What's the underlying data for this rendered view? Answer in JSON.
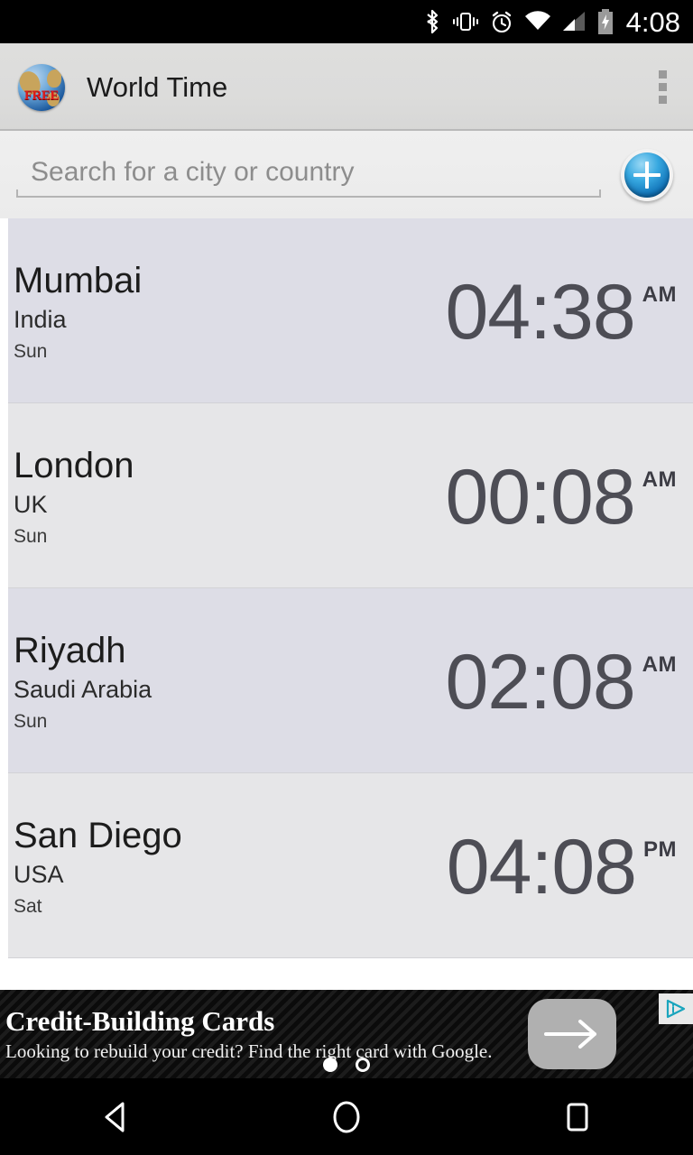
{
  "status_bar": {
    "time": "4:08",
    "icons": [
      "bluetooth-icon",
      "vibrate-icon",
      "alarm-icon",
      "wifi-icon",
      "cell-signal-icon",
      "battery-charging-icon"
    ]
  },
  "action_bar": {
    "app_icon": "globe-free-icon",
    "app_icon_badge": "FREE",
    "title": "World Time",
    "overflow": "overflow-menu-icon"
  },
  "search": {
    "placeholder": "Search for a city or country",
    "value": "",
    "add_button": "add-city-icon"
  },
  "cities": [
    {
      "name": "Mumbai",
      "country": "India",
      "day": "Sun",
      "time": "04:38",
      "ampm": "AM"
    },
    {
      "name": "London",
      "country": "UK",
      "day": "Sun",
      "time": "00:08",
      "ampm": "AM"
    },
    {
      "name": "Riyadh",
      "country": "Saudi Arabia",
      "day": "Sun",
      "time": "02:08",
      "ampm": "AM"
    },
    {
      "name": "San Diego",
      "country": "USA",
      "day": "Sat",
      "time": "04:08",
      "ampm": "PM"
    }
  ],
  "ad": {
    "title": "Credit-Building Cards",
    "subtitle": "Looking to rebuild your credit? Find the right card with Google.",
    "cta": "arrow-right-icon",
    "adchoices": "adchoices-icon",
    "dots": [
      "filled",
      "hollow"
    ]
  },
  "nav_bar": {
    "back": "back-triangle-icon",
    "home": "home-circle-icon",
    "recents": "recents-square-icon"
  },
  "colors": {
    "row_odd": "#dddde6",
    "row_even": "#e6e6e8",
    "action_bar": "#dcdcdb",
    "time_text": "#4d4d55",
    "accent_blue": "#1173b8"
  }
}
